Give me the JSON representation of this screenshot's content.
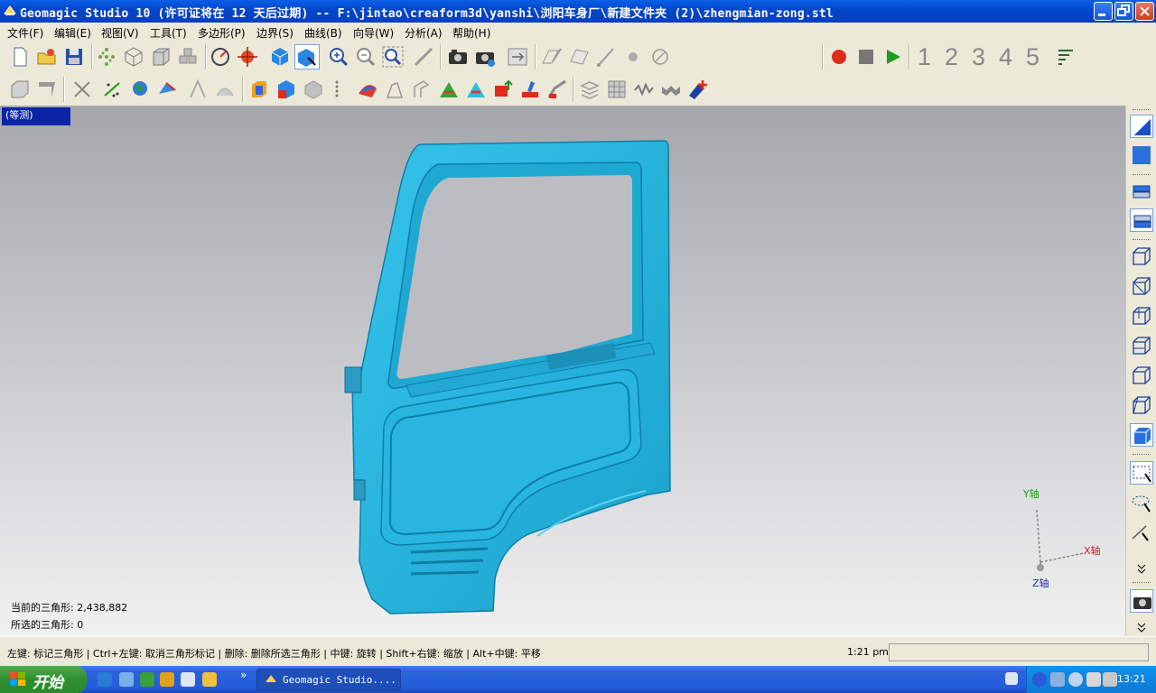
{
  "window": {
    "title": "Geomagic Studio 10 (许可证将在 12 天后过期) -- F:\\jintao\\creaform3d\\yanshi\\浏阳车身厂\\新建文件夹 (2)\\zhengmian-zong.stl"
  },
  "menu": {
    "items": [
      "文件(F)",
      "编辑(E)",
      "视图(V)",
      "工具(T)",
      "多边形(P)",
      "边界(S)",
      "曲线(B)",
      "向导(W)",
      "分析(A)",
      "帮助(H)"
    ]
  },
  "toolbar": {
    "macro_numbers": [
      "1",
      "2",
      "3",
      "4",
      "5"
    ]
  },
  "viewport": {
    "view_label": "(等测)",
    "current_triangles": "当前的三角形: 2,438,882",
    "selected_triangles": "所选的三角形: 0",
    "axis": {
      "y": "Y轴",
      "x": "X轴",
      "z": "Z轴"
    },
    "model_color": "#3fc2e6",
    "background_top": "#a6a7ad",
    "background_bottom": "#f1f1f1"
  },
  "statusbar": {
    "hint": "左键: 标记三角形 | Ctrl+左键: 取消三角形标记 | 删除: 删除所选三角形 | 中键: 旋转 | Shift+右键: 缩放 | Alt+中键: 平移",
    "time": "1:21 pm"
  },
  "taskbar": {
    "start_label": "开始",
    "more": "»",
    "task_label": "Geomagic Studio....",
    "clock": "13:21"
  }
}
